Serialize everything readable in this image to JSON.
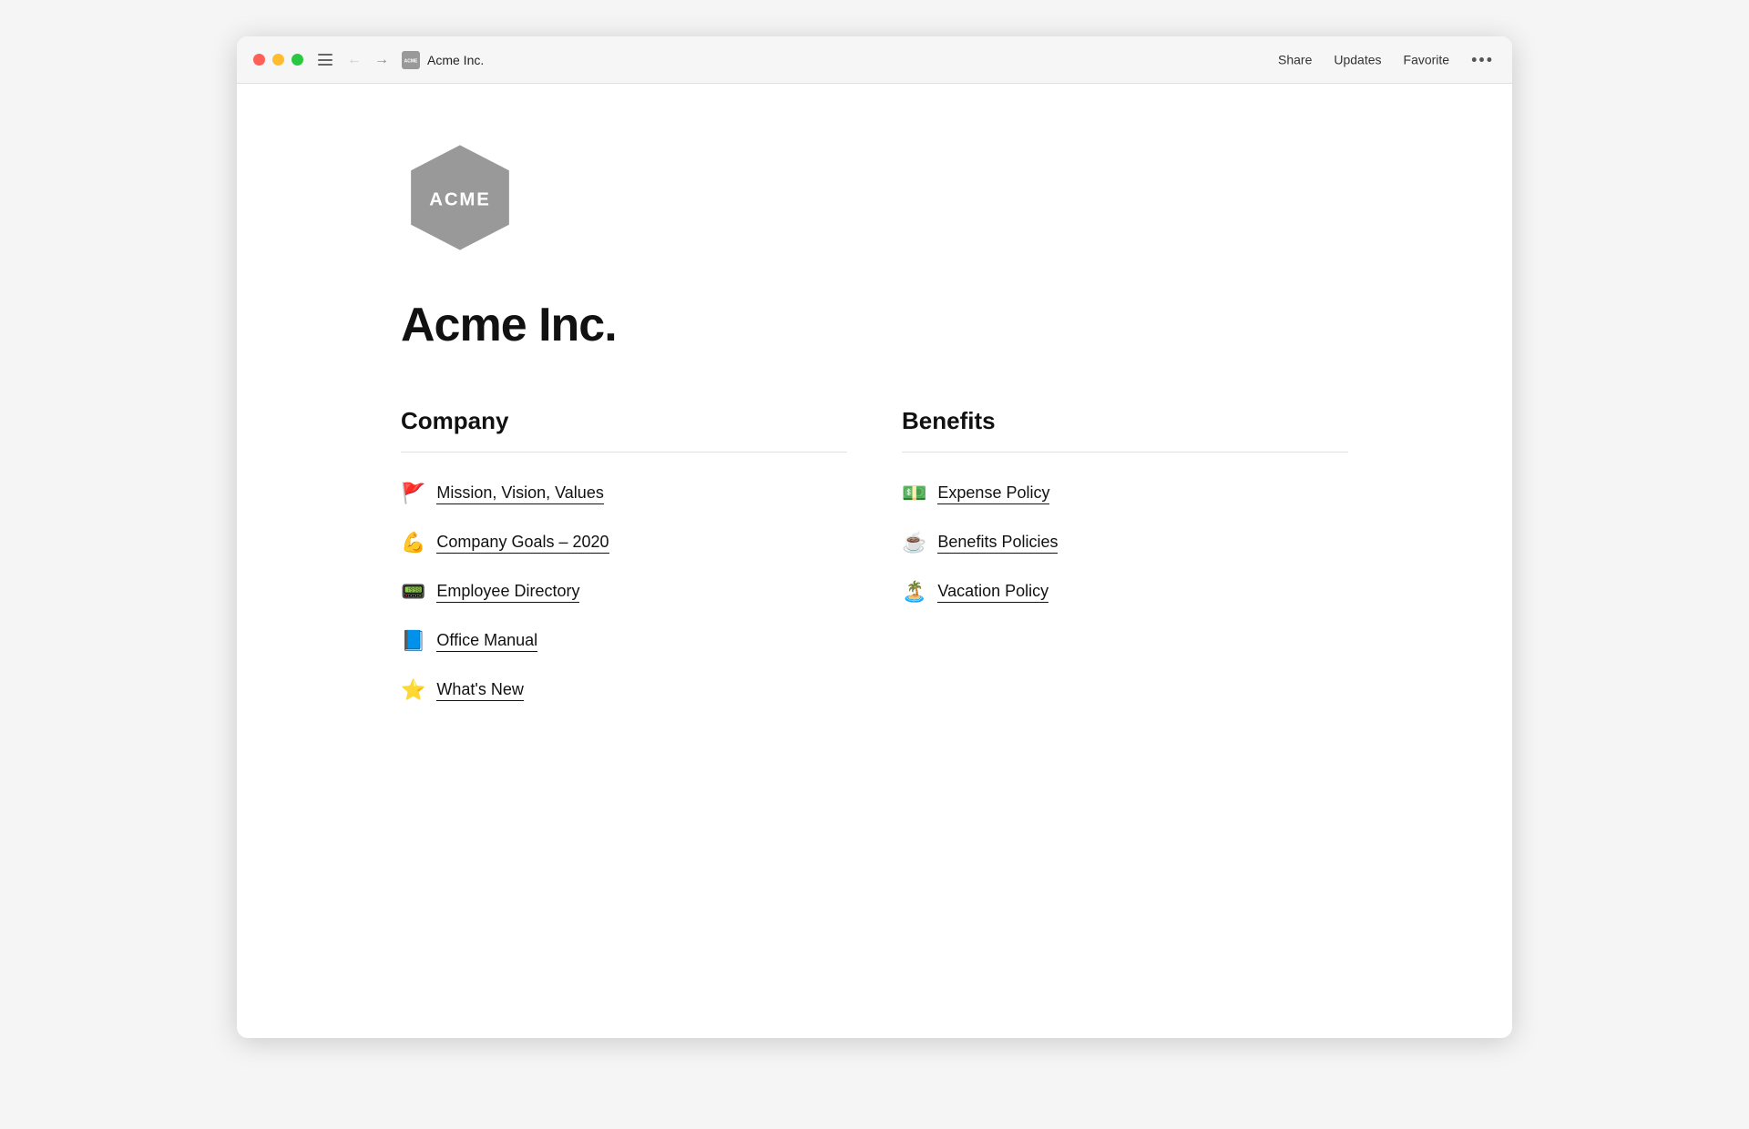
{
  "window": {
    "title": "Acme Inc.",
    "favicon_label": "ACME"
  },
  "titlebar": {
    "back_label": "←",
    "forward_label": "→",
    "breadcrumb": "Acme Inc.",
    "share_label": "Share",
    "updates_label": "Updates",
    "favorite_label": "Favorite",
    "more_label": "•••"
  },
  "page": {
    "title": "Acme Inc.",
    "logo_alt": "Acme Inc. Logo"
  },
  "sections": [
    {
      "id": "company",
      "heading": "Company",
      "links": [
        {
          "emoji": "🚩",
          "label": "Mission, Vision, Values"
        },
        {
          "emoji": "💪",
          "label": "Company Goals – 2020"
        },
        {
          "emoji": "📟",
          "label": "Employee Directory"
        },
        {
          "emoji": "📘",
          "label": "Office Manual"
        },
        {
          "emoji": "⭐",
          "label": "What's New"
        }
      ]
    },
    {
      "id": "benefits",
      "heading": "Benefits",
      "links": [
        {
          "emoji": "💵",
          "label": "Expense Policy"
        },
        {
          "emoji": "☕",
          "label": "Benefits Policies"
        },
        {
          "emoji": "🏝️",
          "label": "Vacation Policy"
        }
      ]
    }
  ]
}
